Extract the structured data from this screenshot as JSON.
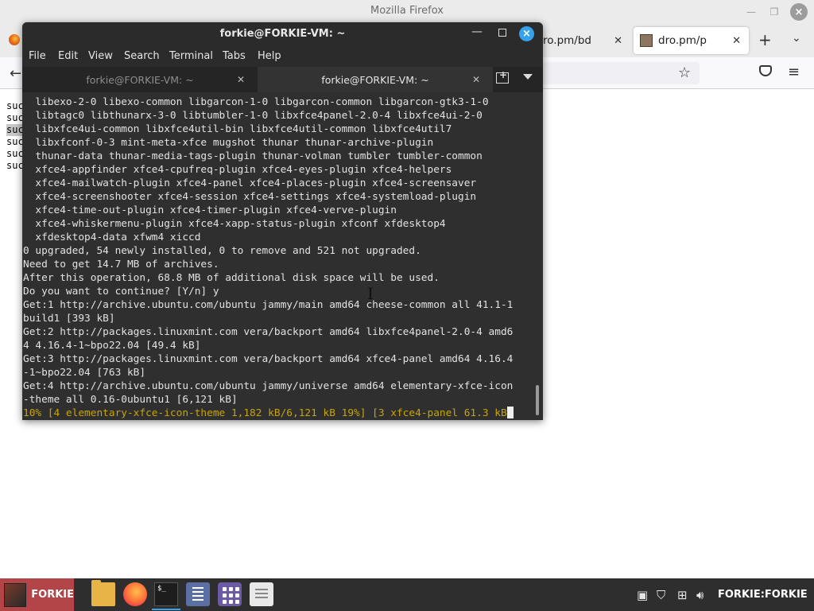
{
  "firefox": {
    "window_title": "Mozilla Firefox",
    "tabs": [
      {
        "label": "ro.pm/bd",
        "active": false
      },
      {
        "label": "dro.pm/p",
        "active": true
      }
    ],
    "page_lines": [
      "suc",
      "suc",
      "suc",
      "suc",
      "suc",
      "suc"
    ]
  },
  "terminal": {
    "title": "forkie@FORKIE-VM: ~",
    "menu": [
      "File",
      "Edit",
      "View",
      "Search",
      "Terminal",
      "Tabs",
      "Help"
    ],
    "tabs": [
      {
        "label": "forkie@FORKIE-VM: ~",
        "active": false
      },
      {
        "label": "forkie@FORKIE-VM: ~",
        "active": true
      }
    ],
    "lines": [
      "  libexo-2-0 libexo-common libgarcon-1-0 libgarcon-common libgarcon-gtk3-1-0",
      "  libtagc0 libthunarx-3-0 libtumbler-1-0 libxfce4panel-2.0-4 libxfce4ui-2-0",
      "  libxfce4ui-common libxfce4util-bin libxfce4util-common libxfce4util7",
      "  libxfconf-0-3 mint-meta-xfce mugshot thunar thunar-archive-plugin",
      "  thunar-data thunar-media-tags-plugin thunar-volman tumbler tumbler-common",
      "  xfce4-appfinder xfce4-cpufreq-plugin xfce4-eyes-plugin xfce4-helpers",
      "  xfce4-mailwatch-plugin xfce4-panel xfce4-places-plugin xfce4-screensaver",
      "  xfce4-screenshooter xfce4-session xfce4-settings xfce4-systemload-plugin",
      "  xfce4-time-out-plugin xfce4-timer-plugin xfce4-verve-plugin",
      "  xfce4-whiskermenu-plugin xfce4-xapp-status-plugin xfconf xfdesktop4",
      "  xfdesktop4-data xfwm4 xiccd",
      "0 upgraded, 54 newly installed, 0 to remove and 521 not upgraded.",
      "Need to get 14.7 MB of archives.",
      "After this operation, 68.8 MB of additional disk space will be used.",
      "Do you want to continue? [Y/n] y",
      "Get:1 http://archive.ubuntu.com/ubuntu jammy/main amd64 cheese-common all 41.1-1",
      "build1 [393 kB]",
      "Get:2 http://packages.linuxmint.com vera/backport amd64 libxfce4panel-2.0-4 amd6",
      "4 4.16.4-1~bpo22.04 [49.4 kB]",
      "Get:3 http://packages.linuxmint.com vera/backport amd64 xfce4-panel amd64 4.16.4",
      "-1~bpo22.04 [763 kB]",
      "Get:4 http://archive.ubuntu.com/ubuntu jammy/universe amd64 elementary-xfce-icon",
      "-theme all 0.16-0ubuntu1 [6,121 kB]"
    ],
    "progress_line": "10% [4 elementary-xfce-icon-theme 1,182 kB/6,121 kB 19%] [3 xfce4-panel 61.3 kB",
    "progress_color": "#c9a500"
  },
  "taskbar": {
    "start_label": "FORKIE",
    "user_label": "FORKIE:FORKIE",
    "launchers": [
      "files-icon",
      "firefox-icon",
      "terminal-icon",
      "text-editor-icon",
      "app-grid-icon",
      "notes-icon"
    ],
    "terminal_launcher_text": "$_",
    "accent": "#b34448"
  }
}
